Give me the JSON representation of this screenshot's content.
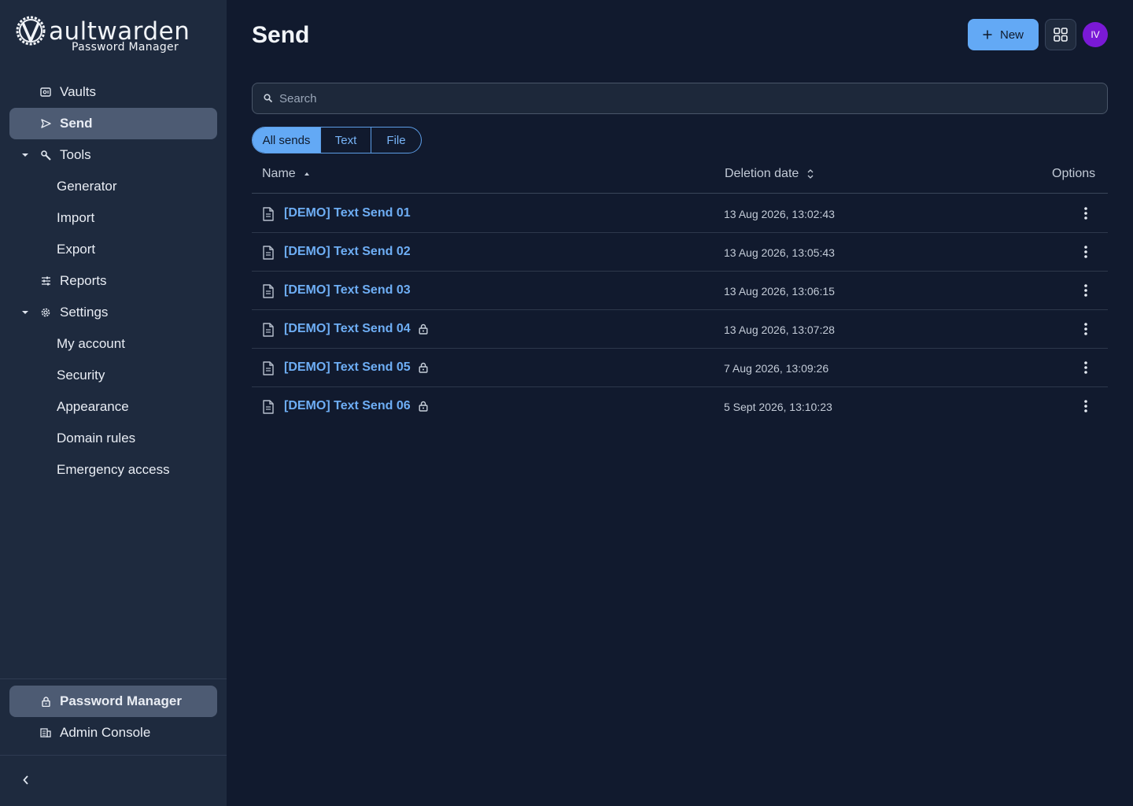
{
  "app": {
    "logo_wordmark": "aultwarden",
    "logo_tagline": "Password Manager"
  },
  "sidebar": {
    "items": [
      {
        "label": "Vaults",
        "icon": "vault-icon"
      },
      {
        "label": "Send",
        "icon": "send-icon",
        "active": true
      },
      {
        "label": "Tools",
        "icon": "wrench-icon",
        "expanded": true
      },
      {
        "label": "Generator"
      },
      {
        "label": "Import"
      },
      {
        "label": "Export"
      },
      {
        "label": "Reports",
        "icon": "sliders-icon"
      },
      {
        "label": "Settings",
        "icon": "gear-icon",
        "expanded": true
      },
      {
        "label": "My account"
      },
      {
        "label": "Security"
      },
      {
        "label": "Appearance"
      },
      {
        "label": "Domain rules"
      },
      {
        "label": "Emergency access"
      }
    ],
    "product_switcher": [
      {
        "label": "Password Manager",
        "icon": "lock-icon",
        "active": true
      },
      {
        "label": "Admin Console",
        "icon": "building-icon"
      }
    ]
  },
  "header": {
    "title": "Send",
    "new_label": "New",
    "avatar_initials": "IV",
    "avatar_color": "#7a19d6"
  },
  "search": {
    "placeholder": "Search",
    "value": ""
  },
  "filters": {
    "options": [
      "All sends",
      "Text",
      "File"
    ],
    "selected": "All sends"
  },
  "table": {
    "columns": {
      "name": "Name",
      "deletion_date": "Deletion date",
      "options": "Options"
    },
    "rows": [
      {
        "name": "[DEMO] Text Send 01",
        "deletion_date": "13 Aug 2026, 13:02:43",
        "password_protected": false
      },
      {
        "name": "[DEMO] Text Send 02",
        "deletion_date": "13 Aug 2026, 13:05:43",
        "password_protected": false
      },
      {
        "name": "[DEMO] Text Send 03",
        "deletion_date": "13 Aug 2026, 13:06:15",
        "password_protected": false
      },
      {
        "name": "[DEMO] Text Send 04",
        "deletion_date": "13 Aug 2026, 13:07:28",
        "password_protected": true
      },
      {
        "name": "[DEMO] Text Send 05",
        "deletion_date": "7 Aug 2026, 13:09:26",
        "password_protected": true
      },
      {
        "name": "[DEMO] Text Send 06",
        "deletion_date": "5 Sept 2026, 13:10:23",
        "password_protected": true
      }
    ]
  },
  "colors": {
    "accent": "#63a9f5",
    "link": "#6eaef5",
    "sidebar_bg": "#1e2a3e",
    "main_bg": "#111a2e",
    "active_nav": "#4d5b73"
  }
}
